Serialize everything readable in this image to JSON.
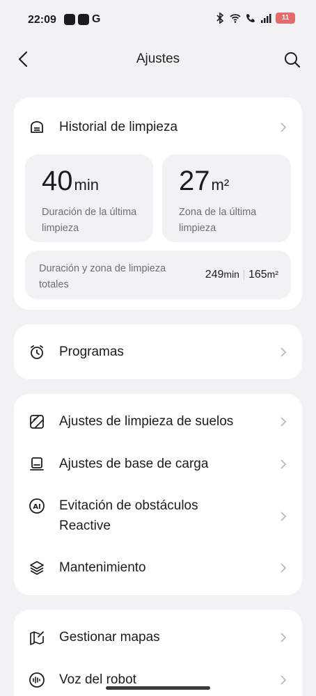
{
  "status_bar": {
    "time": "22:09",
    "app_g": "G",
    "battery": "11"
  },
  "header": {
    "title": "Ajustes"
  },
  "history_card": {
    "title": "Historial de limpieza",
    "last_duration": {
      "value": "40",
      "unit": "min",
      "label": "Duración de la última limpieza"
    },
    "last_area": {
      "value": "27",
      "unit": "m²",
      "label": "Zona de la última limpieza"
    },
    "totals": {
      "label": "Duración y zona de limpieza totales",
      "duration_value": "249",
      "duration_unit": "min",
      "area_value": "165",
      "area_unit": "m²"
    }
  },
  "schedule_card": {
    "label": "Programas"
  },
  "settings_card": {
    "items": [
      {
        "label": "Ajustes de limpieza de suelos",
        "icon": "floor-cleaning-icon"
      },
      {
        "label": "Ajustes de base de carga",
        "icon": "charging-base-icon"
      },
      {
        "label": "Evitación de obstáculos Reactive",
        "icon": "ai-icon"
      },
      {
        "label": "Mantenimiento",
        "icon": "layers-icon"
      }
    ]
  },
  "maps_card": {
    "items": [
      {
        "label": "Gestionar mapas",
        "icon": "map-edit-icon"
      },
      {
        "label": "Voz del robot",
        "icon": "voice-icon"
      }
    ]
  },
  "colors": {
    "background": "#f2f2f4",
    "card": "#ffffff",
    "battery": "#e46b6b"
  }
}
